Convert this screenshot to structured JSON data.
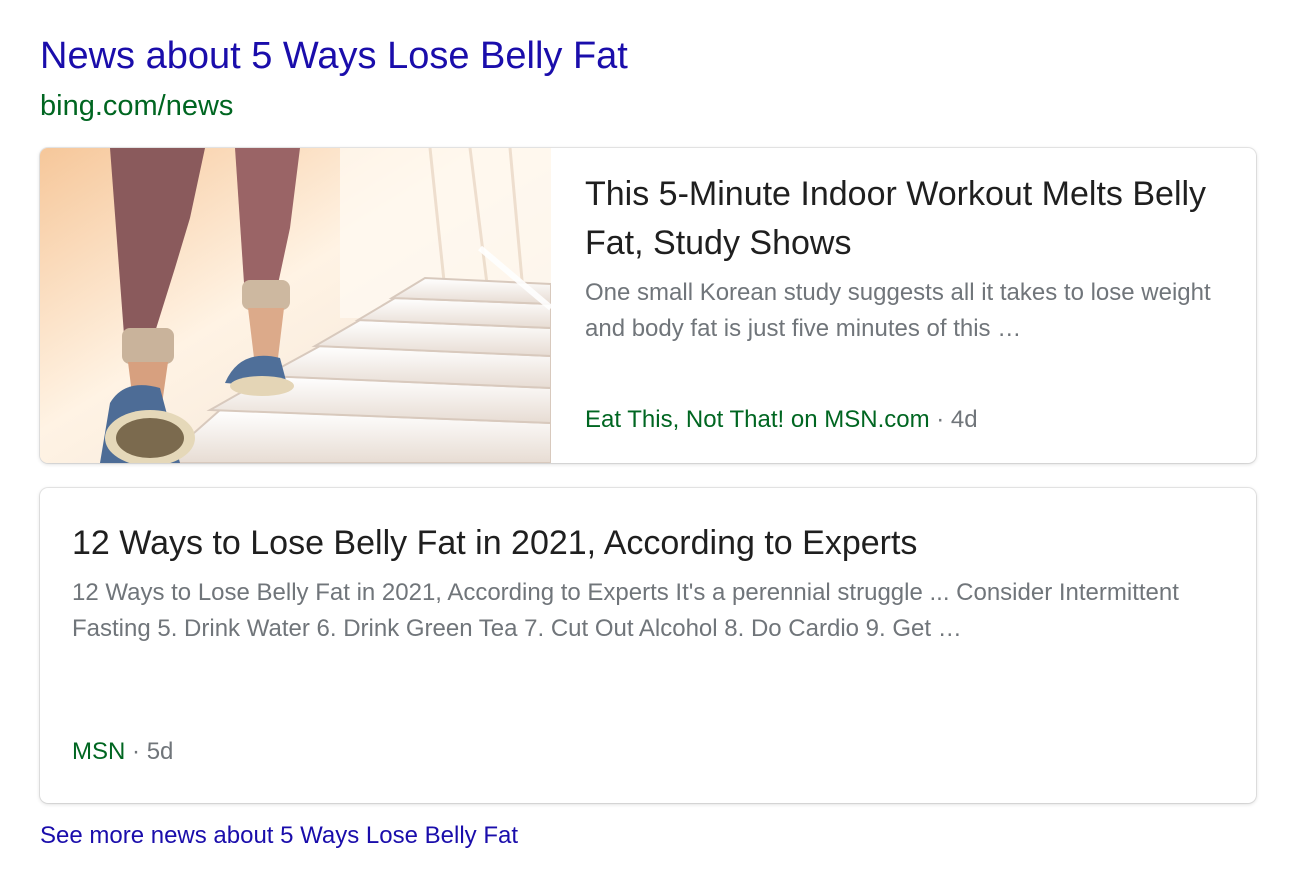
{
  "header": {
    "title": "News about 5 Ways Lose Belly Fat",
    "url": "bing.com/news"
  },
  "articles": [
    {
      "title": "This 5-Minute Indoor Workout Melts Belly Fat, Study Shows",
      "snippet": "One small Korean study suggests all it takes to lose weight and body fat is just five minutes of this …",
      "source": "Eat This, Not That! on MSN.com",
      "separator": "·",
      "age": "4d",
      "thumbnail": "person-climbing-stairs"
    },
    {
      "title": "12 Ways to Lose Belly Fat in 2021, According to Experts",
      "snippet": "12 Ways to Lose Belly Fat in 2021, According to Experts It's a perennial struggle ... Consider Intermittent Fasting 5. Drink Water 6. Drink Green Tea 7. Cut Out Alcohol 8. Do Cardio 9. Get …",
      "source": "MSN",
      "separator": "·",
      "age": "5d"
    }
  ],
  "footer": {
    "see_more": "See more news about 5 Ways Lose Belly Fat"
  },
  "colors": {
    "link": "#1a0dab",
    "url_green": "#006621",
    "title_text": "#1f1f1f",
    "snippet_gray": "#70757a"
  }
}
